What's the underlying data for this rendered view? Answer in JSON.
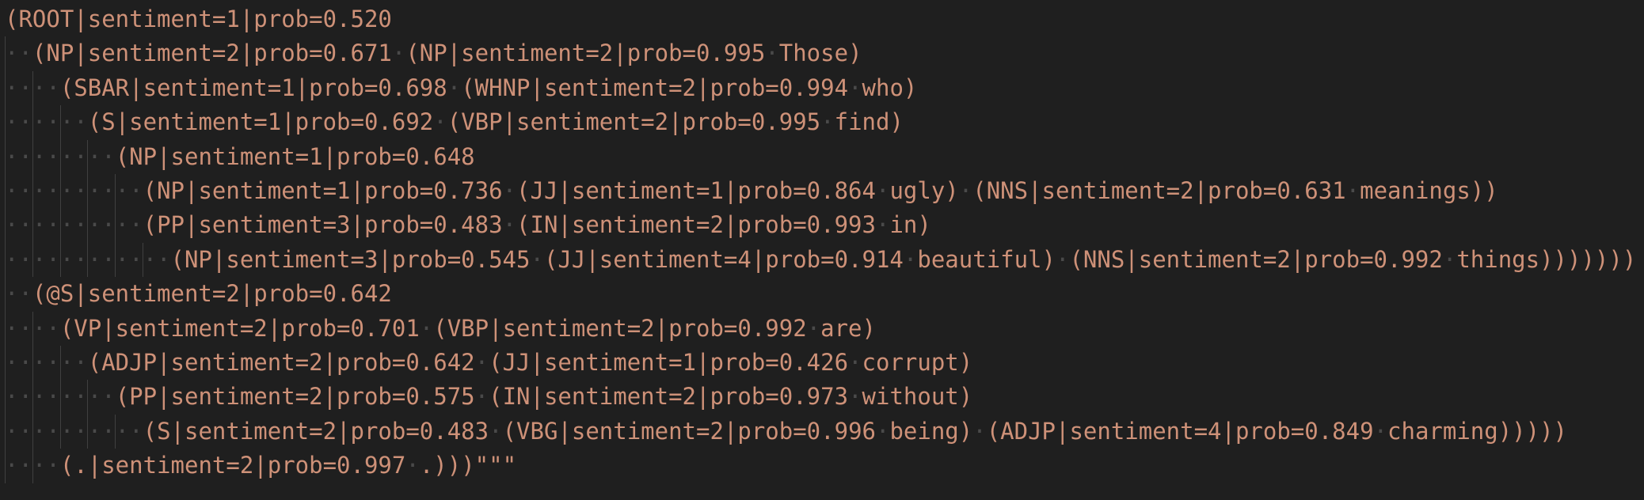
{
  "editor": {
    "lines": [
      "(ROOT|sentiment=1|prob=0.520",
      "··(NP|sentiment=2|prob=0.671·(NP|sentiment=2|prob=0.995·Those)",
      "····(SBAR|sentiment=1|prob=0.698·(WHNP|sentiment=2|prob=0.994·who)",
      "······(S|sentiment=1|prob=0.692·(VBP|sentiment=2|prob=0.995·find)",
      "········(NP|sentiment=1|prob=0.648",
      "··········(NP|sentiment=1|prob=0.736·(JJ|sentiment=1|prob=0.864·ugly)·(NNS|sentiment=2|prob=0.631·meanings))",
      "··········(PP|sentiment=3|prob=0.483·(IN|sentiment=2|prob=0.993·in)",
      "············(NP|sentiment=3|prob=0.545·(JJ|sentiment=4|prob=0.914·beautiful)·(NNS|sentiment=2|prob=0.992·things)))))))",
      "··(@S|sentiment=2|prob=0.642",
      "····(VP|sentiment=2|prob=0.701·(VBP|sentiment=2|prob=0.992·are)",
      "······(ADJP|sentiment=2|prob=0.642·(JJ|sentiment=1|prob=0.426·corrupt)",
      "········(PP|sentiment=2|prob=0.575·(IN|sentiment=2|prob=0.973·without)",
      "··········(S|sentiment=2|prob=0.483·(VBG|sentiment=2|prob=0.996·being)·(ADJP|sentiment=4|prob=0.849·charming)))))",
      "····(.|sentiment=2|prob=0.997·.)))\"\"\""
    ]
  },
  "colors": {
    "background": "#1f1f1f",
    "string_text": "#ce9178",
    "whitespace_marker": "#4a4a4a",
    "indent_guide": "#404040"
  }
}
